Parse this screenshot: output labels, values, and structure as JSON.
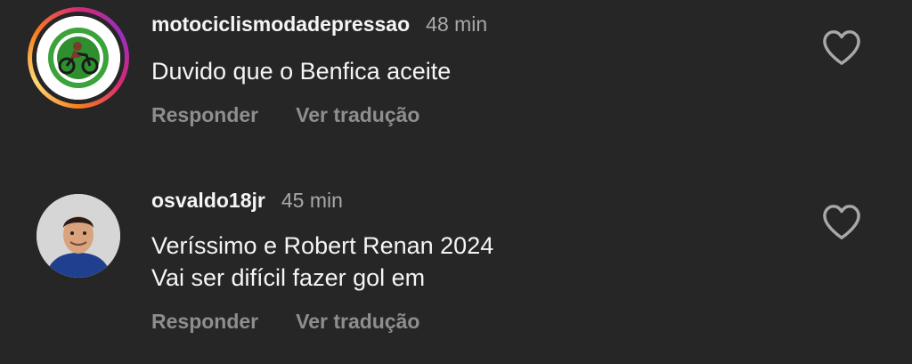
{
  "comments": [
    {
      "username": "motociclismodadepressao",
      "time": "48 min",
      "lines": [
        "Duvido que o Benfica aceite"
      ],
      "reply_label": "Responder",
      "translate_label": "Ver tradução"
    },
    {
      "username": "osvaldo18jr",
      "time": "45 min",
      "lines": [
        "Veríssimo e Robert Renan 2024",
        "Vai ser difícil fazer gol em"
      ],
      "reply_label": "Responder",
      "translate_label": "Ver tradução"
    }
  ],
  "icons": {
    "like": "heart-outline-icon",
    "avatar_1": "motorcycle-club-logo",
    "avatar_2": "person-photo"
  },
  "colors": {
    "background": "#262626",
    "text": "#f5f5f5",
    "secondary": "#a8a8a8",
    "actions": "#8e8e8e"
  }
}
